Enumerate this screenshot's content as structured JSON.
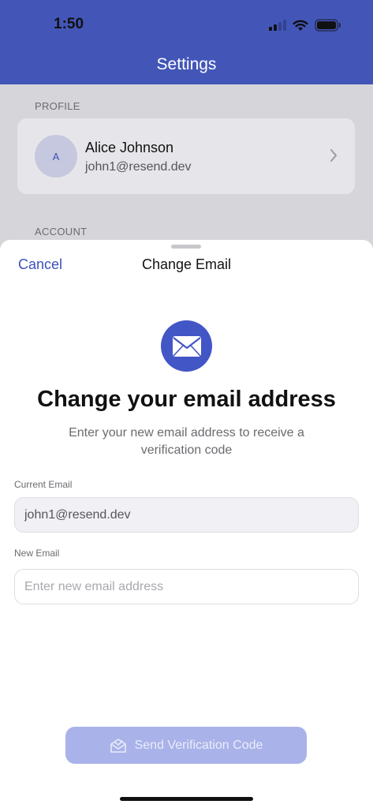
{
  "status_bar": {
    "time": "1:50",
    "icons": [
      "cellular-signal-icon",
      "wifi-icon",
      "battery-icon"
    ]
  },
  "nav": {
    "title": "Settings"
  },
  "background": {
    "profile_section_label": "PROFILE",
    "profile": {
      "avatar_initial": "A",
      "name": "Alice Johnson",
      "email": "john1@resend.dev"
    },
    "account_section_label": "ACCOUNT"
  },
  "sheet": {
    "cancel_label": "Cancel",
    "title": "Change Email",
    "icon": "envelope-icon",
    "headline": "Change your email address",
    "subtext": "Enter your new email address to receive a verification code",
    "current_email": {
      "label": "Current Email",
      "value": "john1@resend.dev"
    },
    "new_email": {
      "label": "New Email",
      "value": "",
      "placeholder": "Enter new email address"
    },
    "send_button": {
      "label": "Send Verification Code",
      "icon": "envelope-open-icon",
      "enabled": false
    }
  },
  "colors": {
    "brand": "#4356b8",
    "accent_text": "#3e51b8",
    "button_disabled": "#a9b3e9",
    "dimmed_background": "#d6d6da"
  }
}
